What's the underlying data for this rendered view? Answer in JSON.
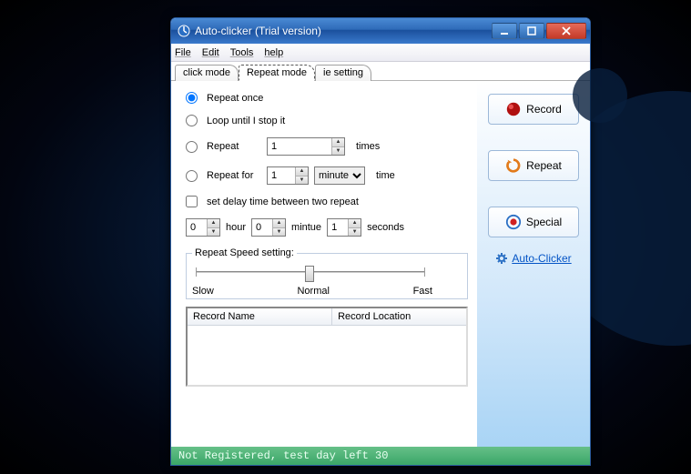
{
  "window": {
    "title": "Auto-clicker (Trial version)"
  },
  "menu": {
    "file": "File",
    "edit": "Edit",
    "tools": "Tools",
    "help": "help"
  },
  "tabs": {
    "click_mode": "click mode",
    "repeat_mode": "Repeat mode",
    "ie_setting": "ie setting"
  },
  "options": {
    "repeat_once": "Repeat once",
    "loop_until_stop": "Loop until I stop it",
    "repeat": "Repeat",
    "repeat_value": "1",
    "repeat_unit": "times",
    "repeat_for": "Repeat for",
    "repeat_for_value": "1",
    "repeat_for_unit_selected": "minute",
    "repeat_for_suffix": "time",
    "set_delay": "set delay time between two repeat",
    "hour_value": "0",
    "hour_label": "hour",
    "minute_value": "0",
    "minute_label": "mintue",
    "second_value": "1",
    "second_label": "seconds"
  },
  "speed": {
    "legend": "Repeat Speed setting:",
    "slow": "Slow",
    "normal": "Normal",
    "fast": "Fast"
  },
  "table": {
    "col1": "Record Name",
    "col2": "Record Location"
  },
  "side": {
    "record": "Record",
    "repeat": "Repeat",
    "special": "Special",
    "link": "Auto-Clicker"
  },
  "status": "Not Registered, test day left 30"
}
